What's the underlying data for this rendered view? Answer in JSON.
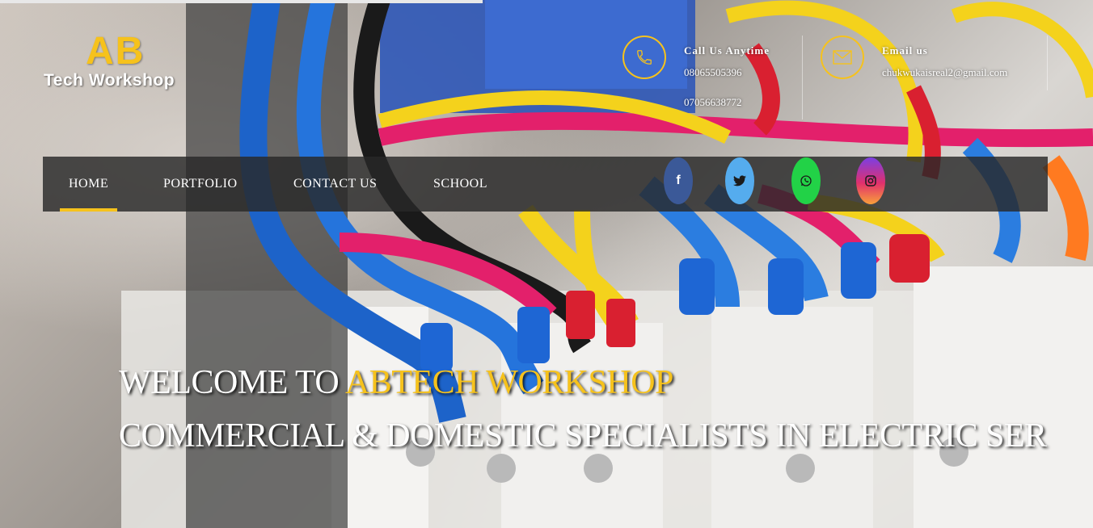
{
  "logo": {
    "mark": "AB",
    "subtitle": "Tech Workshop"
  },
  "contact": {
    "phone": {
      "title": "Call Us Anytime",
      "numbers": [
        "08065505396",
        "07056638772"
      ],
      "icon": "phone-icon"
    },
    "email": {
      "title": "Email us",
      "address": "chukwukaisreal2@gmail.com",
      "icon": "envelope-icon"
    }
  },
  "nav": {
    "items": [
      {
        "label": "HOME",
        "active": true
      },
      {
        "label": "PORTFOLIO",
        "active": false
      },
      {
        "label": "CONTACT US",
        "active": false
      },
      {
        "label": "SCHOOL",
        "active": false
      }
    ]
  },
  "social": [
    {
      "name": "facebook-icon",
      "glyph": "f",
      "color": "#3b5998"
    },
    {
      "name": "twitter-icon",
      "color": "#55acee"
    },
    {
      "name": "whatsapp-icon",
      "color": "#25d366"
    },
    {
      "name": "instagram-icon",
      "color": "#e1306c"
    }
  ],
  "hero": {
    "welcome_prefix": "WELCOME TO ",
    "welcome_accent": "ABTECH WORKSHOP",
    "tagline": "COMMERCIAL & DOMESTIC SPECIALISTS IN ELECTRIC SER"
  },
  "colors": {
    "accent": "#f6c21c",
    "navbar": "#282828"
  }
}
